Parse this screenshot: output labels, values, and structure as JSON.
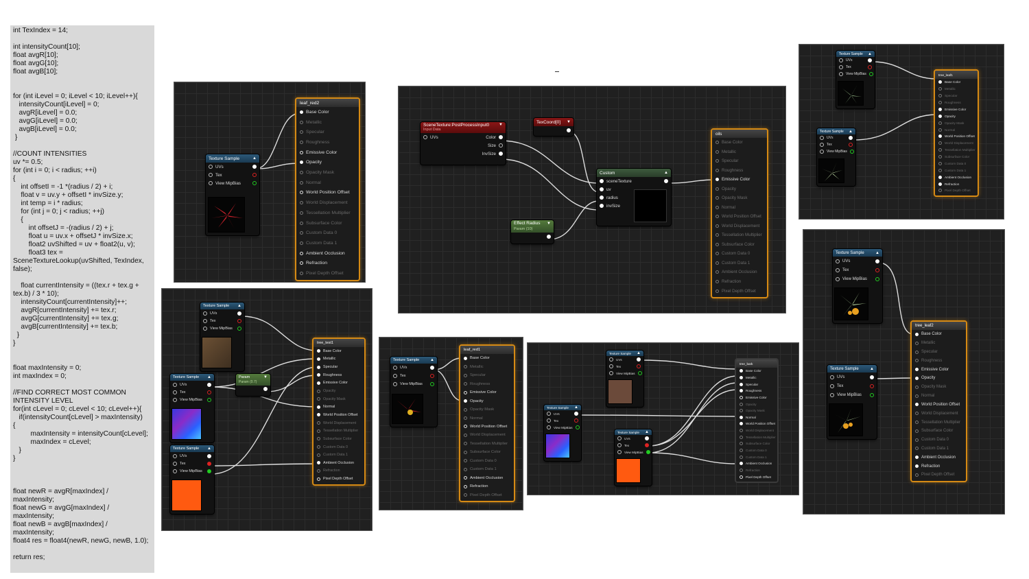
{
  "code": [
    "int TexIndex = 14;",
    "",
    "int intensityCount[10];",
    "float avgR[10];",
    "float avgG[10];",
    "float avgB[10];",
    "",
    "",
    "for (int iLevel = 0; iLevel < 10; iLevel++){",
    "   intensityCount[iLevel] = 0;",
    "   avgR[iLevel] = 0.0;",
    "   avgG[iLevel] = 0.0;",
    "   avgB[iLevel] = 0.0;",
    " }",
    "",
    "//COUNT INTENSITIES",
    "uv *= 0.5;",
    "for (int i = 0; i < radius; ++i)",
    "{",
    "    int offsetI = -1 *(radius / 2) + i;",
    "    float v = uv.y + offsetI * invSize.y;",
    "    int temp = i * radius;",
    "    for (int j = 0; j < radius; ++j)",
    "    {",
    "        int offsetJ = -(radius / 2) + j;",
    "        float u = uv.x + offsetJ * invSize.x;",
    "        float2 uvShifted = uv + float2(u, v);",
    "        float3 tex =",
    "SceneTextureLookup(uvShifted, TexIndex,",
    "false);",
    "",
    "    float currentIntensity = ((tex.r + tex.g +",
    "tex.b) / 3 * 10);",
    "    intensityCount[currentIntensity]++;",
    "    avgR[currentIntensity] += tex.r;",
    "    avgG[currentIntensity] += tex.g;",
    "    avgB[currentIntensity] += tex.b;",
    "  }",
    "}",
    "",
    "",
    "float maxIntensity = 0;",
    "int maxIndex = 0;",
    "",
    "//FIND CORRECT MOST COMMON",
    "INTENSITY LEVEL",
    "for(int cLevel = 0; cLevel < 10; cLevel++){",
    "   if(intensityCount[cLevel] > maxIntensity)",
    "{",
    "         maxIntensity = intensityCount[cLevel];",
    "         maxIndex = cLevel;",
    "   }",
    "}",
    "",
    "",
    "",
    "float newR = avgR[maxIndex] /",
    "maxIntensity;",
    "float newG = avgG[maxIndex] /",
    "maxIntensity;",
    "float newB = avgB[maxIndex] /",
    "maxIntensity;",
    "float4 res = float4(newR, newG, newB, 1.0);",
    "",
    "return res;"
  ],
  "labels": {
    "texture_sample": "Texture Sample",
    "uvs": "UVs",
    "tex": "Tex",
    "view_mip_bias": "View MipBias",
    "param": "Param",
    "param_sub": "Param (0.7)",
    "effect_radius": "Effect Radius",
    "effect_radius_sub": "Param (10)",
    "scene_texture": "SceneTexture:PostProcessInput0",
    "scene_texture_sub": "Input Data",
    "color": "Color",
    "size": "Size",
    "invsize": "InvSize",
    "texcoord": "TexCoord[0]",
    "custom": "Custom",
    "scene_texture_pin": "sceneTexture",
    "uv": "uv",
    "radius": "radius",
    "invsize_pin": "invSize"
  },
  "material_pins": [
    "Base Color",
    "Metallic",
    "Specular",
    "Roughness",
    "Emissive Color",
    "Opacity",
    "Opacity Mask",
    "Normal",
    "World Position Offset",
    "World Displacement",
    "Tessellation Multiplier",
    "Subsurface Color",
    "Custom Data 0",
    "Custom Data 1",
    "Ambient Occlusion",
    "Refraction",
    "Pixel Depth Offset"
  ],
  "materials": {
    "leaf_red2": "leaf_red2",
    "oils": "oils",
    "tree_leaf1": "tree_leaf1",
    "tree_test1": "tree_test1",
    "leaf_red1": "leaf_red1",
    "tree_bark": "tree_bark",
    "tree_leaf2": "tree_leaf2"
  },
  "colors": {
    "result_border": "#d68a14",
    "graph_bg": "#202020",
    "code_bg": "#d9d9d9"
  }
}
